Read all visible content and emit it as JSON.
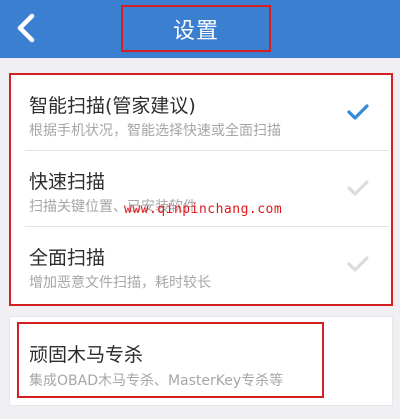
{
  "header": {
    "back_icon": "chevron-left-icon",
    "title": "设置",
    "background_color": "#3b7fd1"
  },
  "scan_options": [
    {
      "title": "智能扫描(管家建议)",
      "description": "根据手机状况，智能选择快速或全面扫描",
      "selected": true
    },
    {
      "title": "快速扫描",
      "description": "扫描关键位置、已安装软件",
      "selected": false
    },
    {
      "title": "全面扫描",
      "description": "增加恶意文件扫描，耗时较长",
      "selected": false
    }
  ],
  "trojan": {
    "title": "顽固木马专杀",
    "description": "集成OBAD木马专杀、MasterKey专杀等"
  },
  "watermark": "www.qinpinchang.com",
  "colors": {
    "check_selected": "#2f8ad8",
    "check_unselected": "#dcdcdc",
    "highlight_border": "#d42020"
  }
}
